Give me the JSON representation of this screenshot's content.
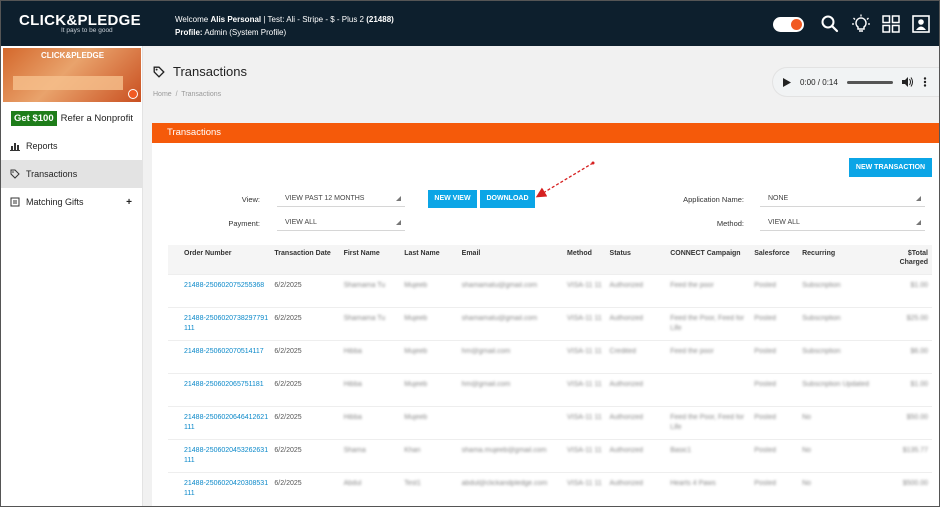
{
  "header": {
    "logo_text": "CLICK&PLEDGE",
    "logo_tagline": "It pays to be good",
    "welcome_prefix": "Welcome",
    "user_name": "Alis Personal",
    "account_text": "| Test: Ali - Stripe - $ - Plus 2",
    "account_id": "(21488)",
    "profile_label": "Profile:",
    "profile_value": "Admin (System Profile)",
    "icons": [
      "toggle-switch",
      "search-icon",
      "lightbulb-icon",
      "grid-icon",
      "user-profile-icon"
    ],
    "accent_color": "#f15a22",
    "bar_color": "#0d1f2d"
  },
  "sidebar": {
    "banner_logo": "CLICK&PLEDGE",
    "refer_badge": "Get $100",
    "refer_text": "Refer a Nonprofit",
    "items": [
      {
        "label": "Reports",
        "icon": "bar-chart-icon",
        "active": false
      },
      {
        "label": "Transactions",
        "icon": "tag-icon",
        "active": true
      },
      {
        "label": "Matching Gifts",
        "icon": "document-icon",
        "active": false,
        "expand": "+"
      }
    ]
  },
  "page": {
    "title": "Transactions",
    "breadcrumb": [
      "Home",
      "/",
      "Transactions"
    ],
    "audio": {
      "time": "0:00 / 0:14"
    },
    "panel_title": "Transactions",
    "panel_color": "#f55a0a",
    "new_transaction_label": "NEW TRANSACTION",
    "filters": {
      "view_label": "View:",
      "view_value": "VIEW PAST 12 MONTHS",
      "payment_label": "Payment:",
      "payment_value": "VIEW ALL",
      "new_view_label": "NEW VIEW",
      "download_label": "DOWNLOAD",
      "application_label": "Application Name:",
      "application_value": "NONE",
      "method_label": "Method:",
      "method_value": "VIEW ALL"
    }
  },
  "table": {
    "columns": [
      "Order Number",
      "Transaction Date",
      "First Name",
      "Last Name",
      "Email",
      "Method",
      "Status",
      "CONNECT Campaign",
      "Salesforce",
      "Recurring",
      "$Total Charged"
    ],
    "rows": [
      [
        "21488-250602075255368",
        "6/2/2025",
        "Shamama Tu",
        "Mujeeb",
        "shamamatu@gmail.com",
        "VISA-11 11",
        "Authorized",
        "Feed the poor",
        "Posted",
        "Subscription",
        "$1.00"
      ],
      [
        "21488-2506020738297791111",
        "6/2/2025",
        "Shamama Tu",
        "Mujeeb",
        "shamamatu@gmail.com",
        "VISA-11 11",
        "Authorized",
        "Feed the Poor, Feed for Life",
        "Posted",
        "Subscription",
        "$25.00"
      ],
      [
        "21488-250602070514117",
        "6/2/2025",
        "Hibba",
        "Mujeeb",
        "hm@gmail.com",
        "VISA-11 11",
        "Credited",
        "Feed the poor",
        "Posted",
        "Subscription",
        "$6.00"
      ],
      [
        "21488-250602065751181",
        "6/2/2025",
        "Hibba",
        "Mujeeb",
        "hm@gmail.com",
        "VISA-11 11",
        "Authorized",
        "",
        "Posted",
        "Subscription Updated",
        "$1.00"
      ],
      [
        "21488-2506020646412621111",
        "6/2/2025",
        "Hibba",
        "Mujeeb",
        "",
        "VISA-11 11",
        "Authorized",
        "Feed the Poor, Feed for Life",
        "Posted",
        "No",
        "$50.00"
      ],
      [
        "21488-2506020453262631111",
        "6/2/2025",
        "Shama",
        "Khan",
        "shama.mujeeb@gmail.com",
        "VISA-11 11",
        "Authorized",
        "Basic1",
        "Posted",
        "No",
        "$135.77"
      ],
      [
        "21488-2506020420308531111",
        "6/2/2025",
        "Abdul",
        "Test1",
        "abdul@clickandpledge.com",
        "VISA-11 11",
        "Authorized",
        "Hearts 4 Paws",
        "Posted",
        "No",
        "$500.00"
      ]
    ]
  }
}
